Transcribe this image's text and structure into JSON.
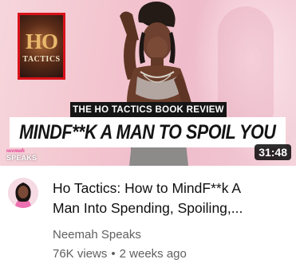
{
  "thumbnail": {
    "book": {
      "title_line1": "HO",
      "title_line2": "TACTICS"
    },
    "subtitle_banner": "THE HO TACTICS BOOK REVIEW",
    "main_banner": "MINDF**K A MAN TO SPOIL YOU",
    "brand": {
      "script": "neemah",
      "word": "SPEAKS"
    },
    "duration": "31:48"
  },
  "video": {
    "title_line1": "Ho Tactics: How to MindF**k A",
    "title_line2": "Man Into Spending, Spoiling,...",
    "channel": "Neemah Speaks",
    "views": "76K views",
    "separator": "•",
    "age": "2 weeks ago"
  },
  "colors": {
    "banner_red": "#d8121a",
    "brand_pink": "#e23a8e",
    "meta_gray": "#606060"
  }
}
